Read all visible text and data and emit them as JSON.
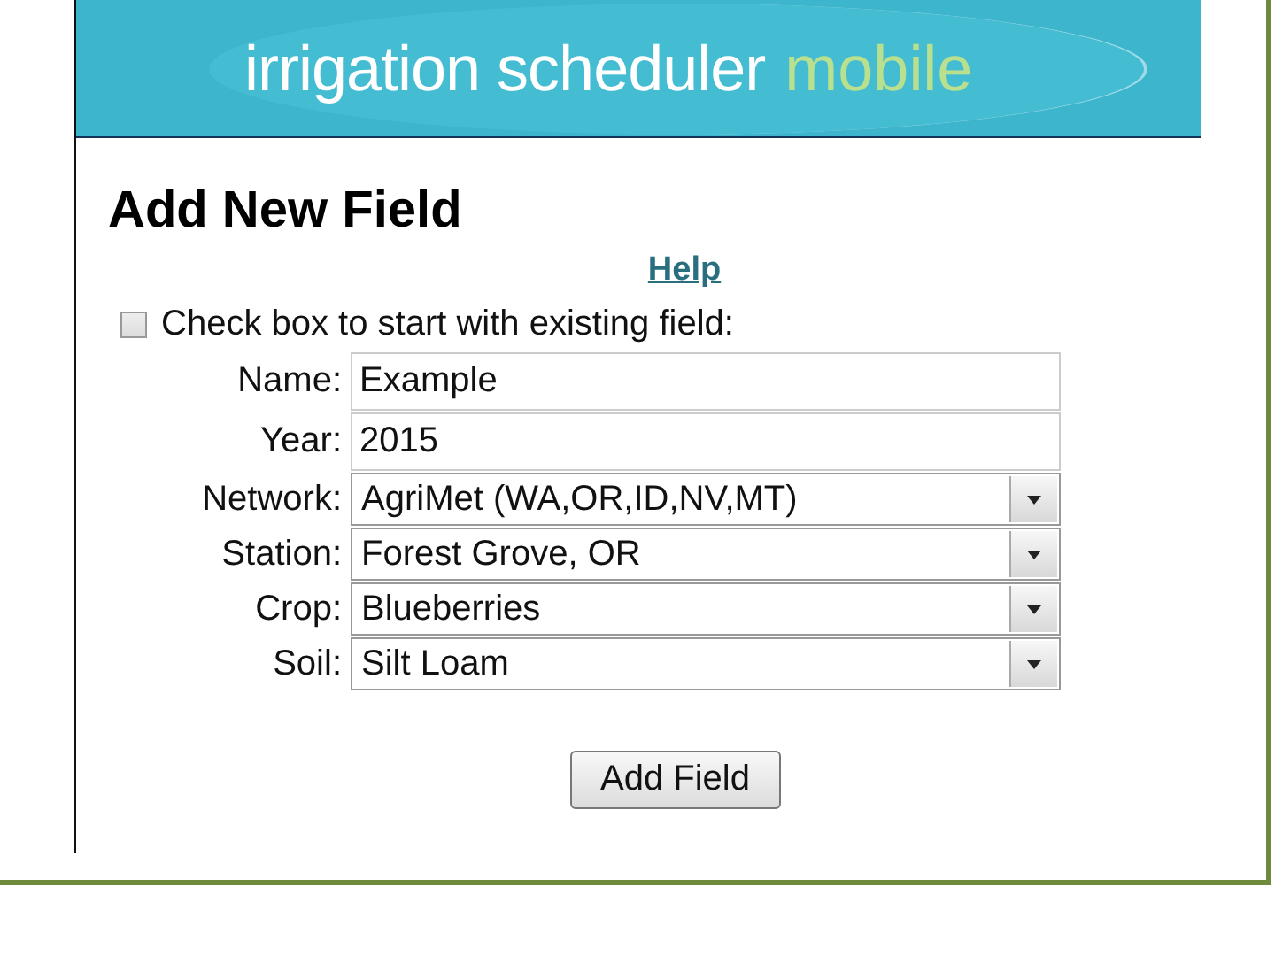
{
  "header": {
    "logo_main": "irrigation scheduler",
    "logo_accent": "mobile"
  },
  "title": "Add New Field",
  "help_link": "Help",
  "existing_field": {
    "label": "Check box to start with existing field:",
    "checked": false
  },
  "fields": [
    {
      "label": "Name:",
      "kind": "text",
      "value": "Example"
    },
    {
      "label": "Year:",
      "kind": "text",
      "value": "2015"
    },
    {
      "label": "Network:",
      "kind": "select",
      "value": "AgriMet (WA,OR,ID,NV,MT)"
    },
    {
      "label": "Station:",
      "kind": "select",
      "value": "Forest Grove, OR"
    },
    {
      "label": "Crop:",
      "kind": "select",
      "value": "Blueberries"
    },
    {
      "label": "Soil:",
      "kind": "select",
      "value": "Silt Loam"
    }
  ],
  "submit_button": "Add Field"
}
